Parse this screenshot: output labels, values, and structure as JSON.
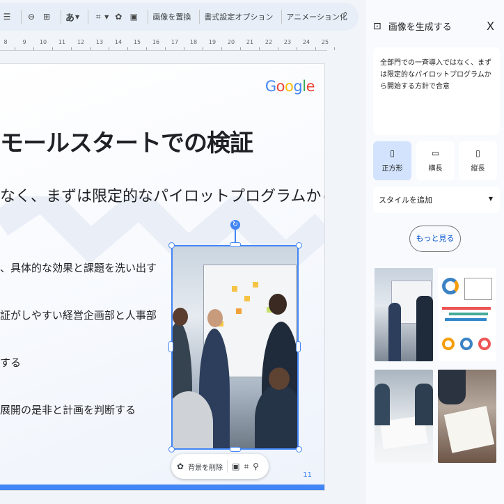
{
  "toolbar": {
    "text_style_label": "あ",
    "replace_image_label": "画像を置換",
    "format_options_label": "書式設定オプション",
    "animation_label": "アニメーション化"
  },
  "ruler": {
    "ticks": [
      "8",
      "9",
      "10",
      "11",
      "12",
      "13",
      "14",
      "15",
      "16",
      "17",
      "18",
      "19",
      "20",
      "21",
      "22",
      "23",
      "24",
      "25"
    ]
  },
  "slide": {
    "logo_letters": [
      "G",
      "o",
      "o",
      "g",
      "l",
      "e"
    ],
    "title": "モールスタートでの検証",
    "subtitle": "なく、まずは限定的なパイロットプログラムから",
    "bullets": [
      "、具体的な効果と課題を洗い出す",
      "証がしやすい経営企画部と人事部",
      "する",
      "展開の是非と計画を判断する"
    ],
    "page_number": "11"
  },
  "image_toolbar": {
    "remove_bg_label": "背景を削除"
  },
  "panel": {
    "title": "画像を生成する",
    "prompt_text": "全部門での一斉導入ではなく、まずは限定的なパイロットプログラムから開始する方針で合意",
    "ratios": [
      {
        "label": "正方形",
        "icon": "▯",
        "active": true
      },
      {
        "label": "横長",
        "icon": "▭",
        "active": false
      },
      {
        "label": "縦長",
        "icon": "▯",
        "active": false
      }
    ],
    "style_select": "スタイルを追加",
    "more_button": "もっと見る"
  },
  "colors": {
    "accent": "#4285f4",
    "selected_ratio_bg": "#d3e3fd",
    "panel_bg": "#f8fafd"
  }
}
